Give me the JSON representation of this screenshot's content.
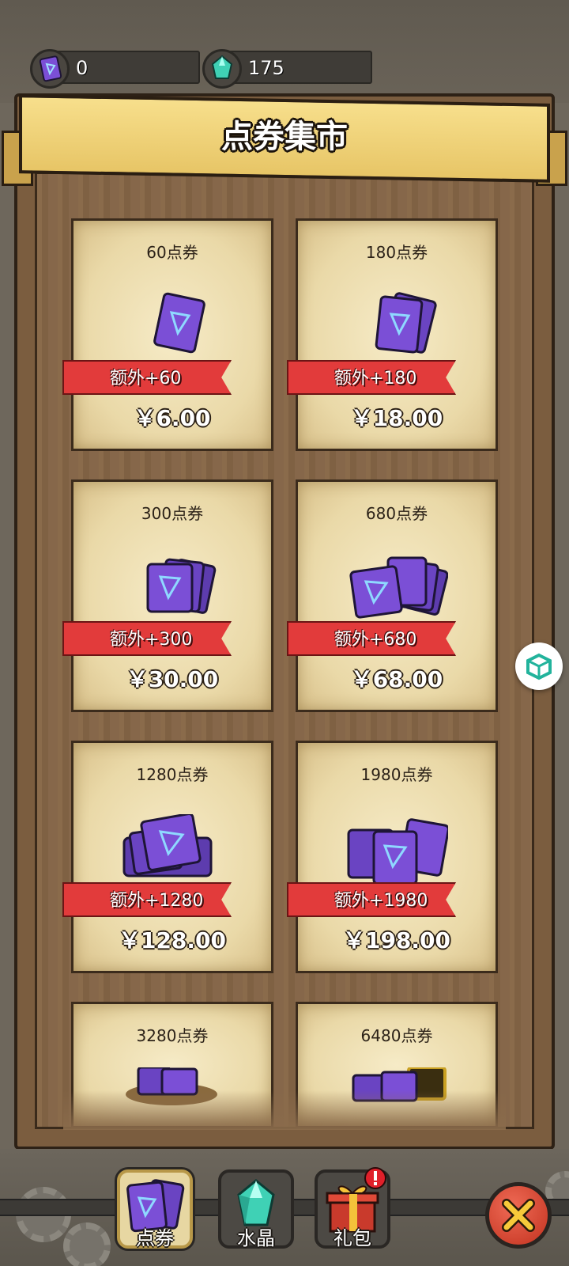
{
  "status": {
    "coupon_value": "0",
    "crystal_value": "175"
  },
  "header": {
    "title": "点券集市"
  },
  "cards": [
    {
      "title": "60点券",
      "bonus": "额外+60",
      "price": "￥6.00"
    },
    {
      "title": "180点券",
      "bonus": "额外+180",
      "price": "￥18.00"
    },
    {
      "title": "300点券",
      "bonus": "额外+300",
      "price": "￥30.00"
    },
    {
      "title": "680点券",
      "bonus": "额外+680",
      "price": "￥68.00"
    },
    {
      "title": "1280点券",
      "bonus": "额外+1280",
      "price": "￥128.00"
    },
    {
      "title": "1980点券",
      "bonus": "额外+1980",
      "price": "￥198.00"
    },
    {
      "title": "3280点券",
      "bonus": "",
      "price": ""
    },
    {
      "title": "6480点券",
      "bonus": "",
      "price": ""
    }
  ],
  "tabs": [
    {
      "label": "点券",
      "icon": "coupon-icon",
      "active": true
    },
    {
      "label": "水晶",
      "icon": "crystal-icon",
      "active": false
    },
    {
      "label": "礼包",
      "icon": "gift-icon",
      "active": false
    }
  ],
  "colors": {
    "ribbon": "#e23b3b",
    "coupon_purple": "#7b4fd6",
    "crystal_teal": "#3fd1b5",
    "banner_yellow": "#f2d57e"
  }
}
